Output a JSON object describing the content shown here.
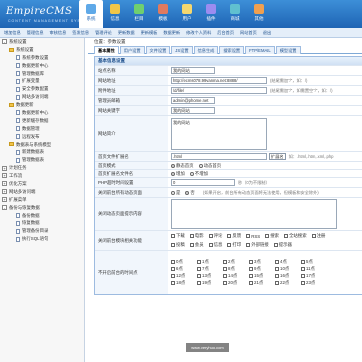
{
  "header": {
    "logo": "EmpireCMS",
    "logo_sub": "CONTENT MANAGEMENT SYSTEM",
    "nav": [
      {
        "label": "系统",
        "icon": "system-icon",
        "color": "#5fa9e8"
      },
      {
        "label": "信息",
        "icon": "info-icon",
        "color": "#f0c648"
      },
      {
        "label": "栏目",
        "icon": "column-icon",
        "color": "#6fcf6f"
      },
      {
        "label": "模板",
        "icon": "template-icon",
        "color": "#e07a5f"
      },
      {
        "label": "用户",
        "icon": "user-icon",
        "color": "#f5d76e"
      },
      {
        "label": "插件",
        "icon": "plugin-icon",
        "color": "#9b8cf0"
      },
      {
        "label": "商城",
        "icon": "shop-icon",
        "color": "#60c0d0"
      },
      {
        "label": "其他",
        "icon": "other-icon",
        "color": "#f0a050"
      }
    ]
  },
  "submenu": [
    "增加信息",
    "管理信息",
    "审核信息",
    "签发信息",
    "管理评论",
    "更新数据",
    "更新模板",
    "数据更新",
    "修改个人资料",
    "后台首页",
    "网站首页",
    "退出"
  ],
  "sidebar": [
    {
      "label": "系统设置",
      "depth": 0,
      "kind": "box",
      "sign": "-"
    },
    {
      "label": "系统设置",
      "depth": 1,
      "kind": "fold"
    },
    {
      "label": "系统参数设置",
      "depth": 2,
      "kind": "page"
    },
    {
      "label": "数据更新中心",
      "depth": 2,
      "kind": "page"
    },
    {
      "label": "管理数据库",
      "depth": 2,
      "kind": "page"
    },
    {
      "label": "扩展变量",
      "depth": 2,
      "kind": "page"
    },
    {
      "label": "安全参数配置",
      "depth": 2,
      "kind": "page"
    },
    {
      "label": "网站多访问端",
      "depth": 2,
      "kind": "page"
    },
    {
      "label": "数据更新",
      "depth": 1,
      "kind": "fold"
    },
    {
      "label": "数据更新中心",
      "depth": 2,
      "kind": "page"
    },
    {
      "label": "更新缓存数据",
      "depth": 2,
      "kind": "page"
    },
    {
      "label": "数据管理",
      "depth": 2,
      "kind": "page"
    },
    {
      "label": "远程发布",
      "depth": 2,
      "kind": "page"
    },
    {
      "label": "数据表与系统模型",
      "depth": 1,
      "kind": "fold"
    },
    {
      "label": "新建数据表",
      "depth": 2,
      "kind": "page"
    },
    {
      "label": "管理数据表",
      "depth": 2,
      "kind": "page"
    },
    {
      "label": "计划任务",
      "depth": 0,
      "kind": "box",
      "sign": "+"
    },
    {
      "label": "工作流",
      "depth": 0,
      "kind": "box",
      "sign": "+"
    },
    {
      "label": "优化方案",
      "depth": 0,
      "kind": "box",
      "sign": "+"
    },
    {
      "label": "网站多访问端",
      "depth": 0,
      "kind": "box",
      "sign": "+"
    },
    {
      "label": "扩展菜单",
      "depth": 0,
      "kind": "box",
      "sign": "+"
    },
    {
      "label": "备份与恢复数据",
      "depth": 0,
      "kind": "box",
      "sign": "-"
    },
    {
      "label": "备份数据",
      "depth": 2,
      "kind": "page"
    },
    {
      "label": "恢复数据",
      "depth": 2,
      "kind": "page"
    },
    {
      "label": "管理备份目录",
      "depth": 2,
      "kind": "page"
    },
    {
      "label": "执行SQL语句",
      "depth": 2,
      "kind": "page"
    }
  ],
  "breadcrumb": "位置：参数设置",
  "tabs": [
    {
      "label": "基本属性",
      "active": true
    },
    {
      "label": "用户设置"
    },
    {
      "label": "文件设置"
    },
    {
      "label": "JS设置"
    },
    {
      "label": "信息生成"
    },
    {
      "label": "搜索设置"
    },
    {
      "label": "FTP/EMAIL"
    },
    {
      "label": "模型设置"
    }
  ],
  "section_title": "基本信息设置",
  "form": {
    "site_name": {
      "label": "站点名称",
      "value": "我的网站"
    },
    "site_url": {
      "label": "网站地址",
      "value": "http://ecms078.99vanma.net:8888/",
      "note": "(结尾需加\"/\"，如：/)"
    },
    "attach_url": {
      "label": "附件地址",
      "value": "/d/file/",
      "note": "(结尾需加\"/\"，如需置空\"/\"，如：/)"
    },
    "email": {
      "label": "管理员邮箱",
      "value": "admin@phome.net"
    },
    "keywords": {
      "label": "网站关键字",
      "value": "我的网站"
    },
    "intro": {
      "label": "网站简介",
      "value": "我的网站"
    },
    "index_file": {
      "label": "首页文件扩展名",
      "value": ".html",
      "select": "扩展名",
      "note": "如：.html,.htm,.xml,.php"
    },
    "index_mode": {
      "label": "首页模式",
      "options": [
        "静态首页",
        "动态首页"
      ],
      "selected": 0
    },
    "index_ext": {
      "label": "首页扩展名文件名",
      "options": [
        "增加",
        "不增加"
      ],
      "selected": 0
    },
    "php_timeout": {
      "label": "PHP超时时间设置",
      "value": "0",
      "note": "秒（0为不限制）"
    },
    "close_site": {
      "label": "关闭前台所有动态页面",
      "options": [
        "是",
        "否"
      ],
      "selected": 1,
      "note": "(如果开启，前台所有动态页面将无法使用，但模板和安全除外)"
    },
    "close_msg": {
      "label": "关闭动态页面提示内容"
    },
    "close_modules": {
      "label": "关闭前台模块相关功能",
      "items": [
        "下载",
        "电影",
        "评论",
        "反馈",
        "RSS",
        "搜索",
        "全站搜索",
        "注册",
        "投稿",
        "会员",
        "信息",
        "打印",
        "外部链接",
        "提示器"
      ]
    },
    "forbid_dirs": {
      "label": "不开启前台的时间点",
      "hours": [
        "0点",
        "1点",
        "2点",
        "3点",
        "4点",
        "5点",
        "6点",
        "7点",
        "8点",
        "9点",
        "10点",
        "11点",
        "12点",
        "13点",
        "14点",
        "15点",
        "16点",
        "17点",
        "18点",
        "19点",
        "20点",
        "21点",
        "22点",
        "23点"
      ]
    }
  },
  "watermark": "www.veryhuo.com"
}
